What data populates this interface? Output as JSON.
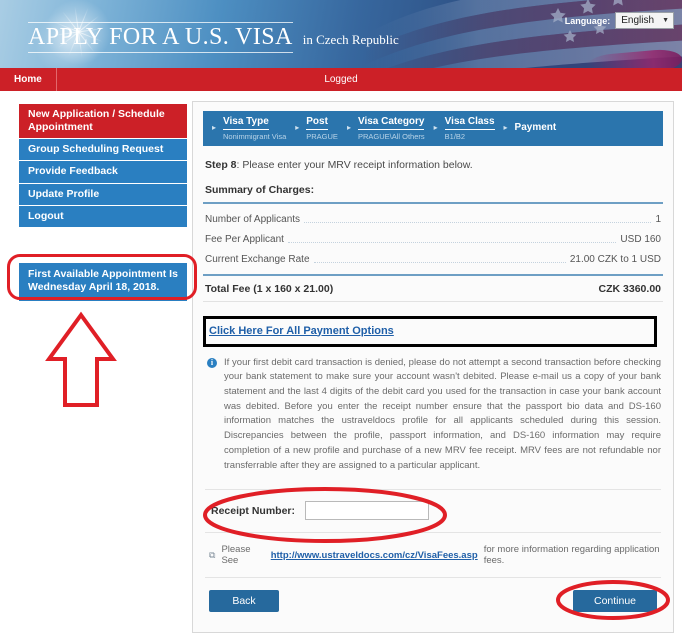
{
  "header": {
    "title": "APPLY FOR A U.S. VISA",
    "subtitle": "in  Czech Republic",
    "language_label": "Language:",
    "language_value": "English",
    "language_caret": "▼"
  },
  "navbar": {
    "home": "Home",
    "status": "Logged"
  },
  "sidebar": {
    "items": [
      {
        "label": "New Application / Schedule Appointment",
        "active": true
      },
      {
        "label": "Group Scheduling Request",
        "active": false
      },
      {
        "label": "Provide Feedback",
        "active": false
      },
      {
        "label": "Update Profile",
        "active": false
      },
      {
        "label": "Logout",
        "active": false
      }
    ],
    "appointment_notice": "First Available Appointment Is Wednesday April 18, 2018."
  },
  "breadcrumb": {
    "separator": "▸",
    "steps": [
      {
        "title": "Visa Type",
        "sub": "Nonimmigrant Visa"
      },
      {
        "title": "Post",
        "sub": "PRAGUE"
      },
      {
        "title": "Visa Category",
        "sub": "PRAGUE\\All Others"
      },
      {
        "title": "Visa Class",
        "sub": "B1/B2"
      },
      {
        "title": "Payment",
        "sub": ""
      }
    ]
  },
  "main": {
    "step_bold": "Step 8",
    "step_rest": ": Please enter your MRV receipt information below.",
    "charges_heading": "Summary of Charges:",
    "charges": [
      {
        "label": "Number of Applicants",
        "value": "1"
      },
      {
        "label": "Fee Per Applicant",
        "value": "USD 160"
      },
      {
        "label": "Current Exchange Rate",
        "value": "21.00 CZK to 1 USD"
      }
    ],
    "total_label": "Total Fee (1 x 160 x 21.00)",
    "total_value": "CZK 3360.00",
    "payment_options_link": "Click Here For All Payment Options",
    "info_icon": "i",
    "info_text": "If your first debit card transaction is denied, please do not attempt a second transaction before checking your bank statement to make sure your account wasn't debited. Please e-mail us a copy of your bank statement and the last 4 digits of the debit card you used for the transaction in case your bank account was debited. Before you enter the receipt number ensure that the passport bio data and DS-160 information matches the ustraveldocs profile for all applicants scheduled during this session. Discrepancies between the profile, passport information, and DS-160 information may require completion of a new profile and purchase of a new MRV fee receipt. MRV fees are not refundable nor transferrable after they are assigned to a particular applicant.",
    "receipt_label": "Receipt Number:",
    "receipt_value": "",
    "receipt_placeholder": "",
    "fees_icon": "⧉",
    "fees_prefix": "Please See",
    "fees_link": "http://www.ustraveldocs.com/cz/VisaFees.asp",
    "fees_suffix": "for more information regarding application fees.",
    "back_label": "Back",
    "continue_label": "Continue"
  },
  "colors": {
    "brand_red": "#cc2027",
    "brand_blue": "#2a7fc1",
    "crumb_blue": "#2b75ad",
    "button_blue": "#26699d",
    "annotation_red": "#e01f26",
    "annotation_black": "#000000"
  }
}
